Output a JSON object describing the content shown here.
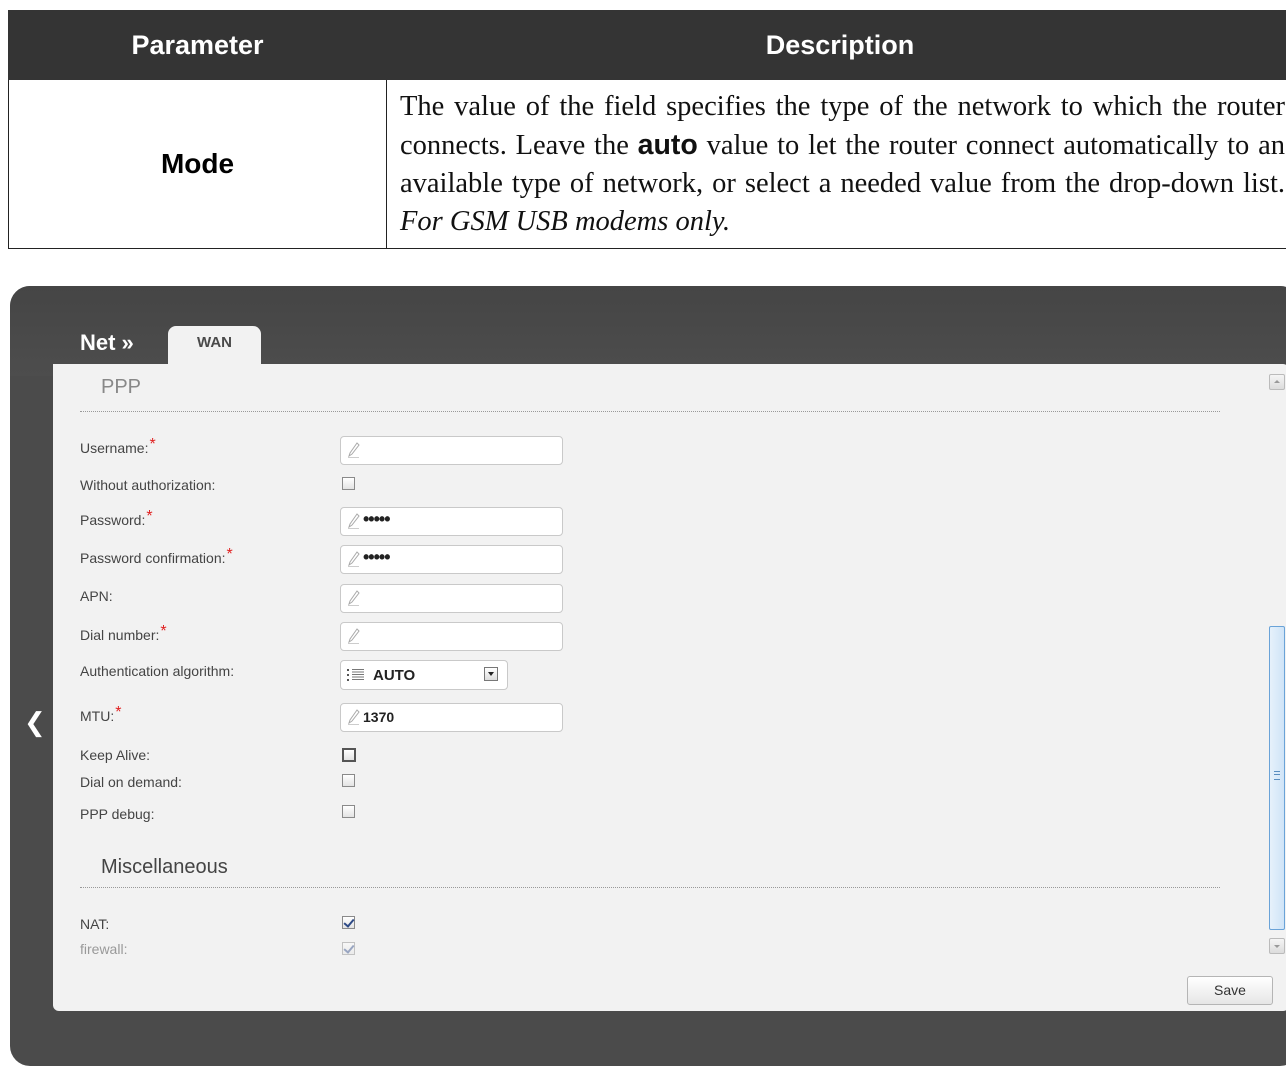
{
  "table": {
    "header_param": "Parameter",
    "header_desc": "Description",
    "row": {
      "param": "Mode",
      "desc_part1": "The value of the field specifies the type of the network to which the router connects. Leave the ",
      "desc_kw": "auto",
      "desc_part2": " value to let the router connect automatically to an available type of network, or select a needed value from the drop-down list. ",
      "desc_italic": "For GSM USB modems only."
    }
  },
  "ui": {
    "breadcrumb": "Net »",
    "tab": "WAN",
    "back_icon": "chevron-left-icon",
    "ppp_section": "PPP",
    "misc_section": "Miscellaneous",
    "fields": {
      "username_label": "Username:",
      "without_auth_label": "Without authorization:",
      "password_label": "Password:",
      "password_value": "•••••",
      "password_confirm_label": "Password confirmation:",
      "password_confirm_value": "•••••",
      "apn_label": "APN:",
      "dial_number_label": "Dial number:",
      "auth_algo_label": "Authentication algorithm:",
      "auth_algo_value": "AUTO",
      "mtu_label": "MTU:",
      "mtu_value": "1370",
      "keep_alive_label": "Keep Alive:",
      "dial_on_demand_label": "Dial on demand:",
      "ppp_debug_label": "PPP debug:",
      "nat_label": "NAT:",
      "firewall_label": "firewall:"
    },
    "required_mark": "*",
    "checkboxes": {
      "without_auth": false,
      "keep_alive": false,
      "dial_on_demand": false,
      "ppp_debug": false,
      "nat": true,
      "firewall": true
    },
    "save_label": "Save",
    "colors": {
      "frame": "#4b4b4b",
      "panel": "#f2f2f2",
      "required": "#e02020",
      "header": "#343434"
    }
  }
}
